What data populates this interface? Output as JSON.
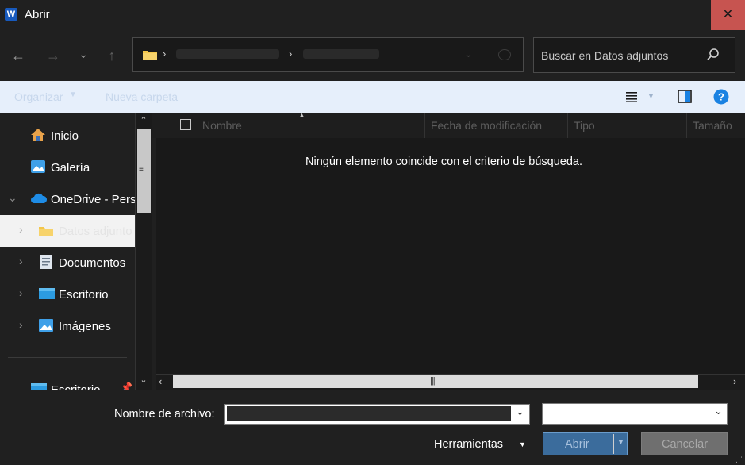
{
  "window": {
    "title": "Abrir",
    "app_icon_letter": "W",
    "close_glyph": "✕"
  },
  "nav": {
    "back_glyph": "←",
    "forward_glyph": "→",
    "recent_glyph": "⌄",
    "up_glyph": "↑"
  },
  "search": {
    "placeholder": "Buscar en Datos adjuntos"
  },
  "toolbar": {
    "organize_label": "Organizar",
    "new_folder_label": "Nueva carpeta",
    "help_glyph": "?"
  },
  "sidebar": {
    "items": [
      {
        "label": "Inicio",
        "icon": "home-icon"
      },
      {
        "label": "Galería",
        "icon": "gallery-icon"
      },
      {
        "label": "OneDrive - Perso",
        "icon": "cloud-icon"
      },
      {
        "label": "Datos adjunto",
        "icon": "folder-icon"
      },
      {
        "label": "Documentos",
        "icon": "documents-icon"
      },
      {
        "label": "Escritorio",
        "icon": "desktop-icon"
      },
      {
        "label": "Imágenes",
        "icon": "pictures-icon"
      },
      {
        "label": "Escritorio",
        "icon": "desktop-icon"
      }
    ]
  },
  "columns": {
    "name": "Nombre",
    "modified": "Fecha de modificación",
    "type": "Tipo",
    "size": "Tamaño"
  },
  "content": {
    "empty_message": "Ningún elemento coincide con el criterio de búsqueda."
  },
  "footer": {
    "filename_label": "Nombre de archivo:",
    "filename_value": "",
    "tools_label": "Herramientas",
    "open_label": "Abrir",
    "cancel_label": "Cancelar"
  },
  "colors": {
    "close_button": "#c75450",
    "toolbar_bg": "#e6effb",
    "open_button": "#3b6c9c",
    "help_icon": "#1a82e2"
  }
}
